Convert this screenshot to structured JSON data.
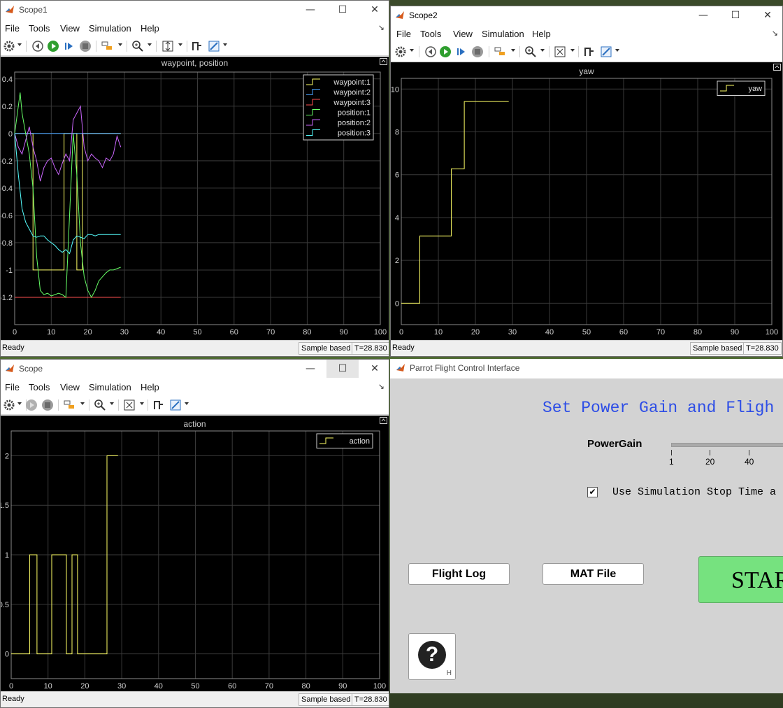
{
  "menus": [
    "File",
    "Tools",
    "View",
    "Simulation",
    "Help"
  ],
  "status": {
    "ready": "Ready",
    "mode": "Sample based",
    "time": "T=28.830"
  },
  "scope1": {
    "title": "Scope1",
    "plot_title": "waypoint, position",
    "chart_data": {
      "type": "line",
      "title": "waypoint, position",
      "xlim": [
        0,
        100
      ],
      "ylim": [
        -1.4,
        0.45
      ],
      "xticks": [
        0,
        10,
        20,
        30,
        40,
        50,
        60,
        70,
        80,
        90,
        100
      ],
      "yticks": [
        0.4,
        0.2,
        0,
        -0.2,
        -0.4,
        -0.6,
        -0.8,
        -1,
        -1.2
      ],
      "ytick_labels": [
        "0.4",
        "0.2",
        "0",
        "-0.2",
        "-0.4",
        "-0.6",
        "-0.8",
        "-1",
        "-1.2"
      ],
      "grid": true,
      "legend_position": "top-right",
      "series": [
        {
          "name": "waypoint:1",
          "color": "#ffff66",
          "x": [
            0,
            5,
            5,
            13.5,
            13.5,
            17,
            17,
            18.5,
            18.5,
            29
          ],
          "y": [
            0,
            0,
            -1,
            -1,
            0,
            0,
            -1,
            -1,
            0,
            0
          ]
        },
        {
          "name": "waypoint:2",
          "color": "#4aa3ff",
          "x": [
            0,
            29
          ],
          "y": [
            0,
            0
          ]
        },
        {
          "name": "waypoint:3",
          "color": "#ff5050",
          "x": [
            0,
            29
          ],
          "y": [
            -1.2,
            -1.2
          ]
        },
        {
          "name": "position:1",
          "color": "#66ff66",
          "x": [
            0,
            1,
            1.5,
            2,
            3,
            4,
            5,
            6,
            7,
            8,
            9,
            10,
            11,
            12,
            13,
            14,
            15,
            16,
            17,
            18,
            19,
            20,
            21,
            22,
            23,
            24,
            25,
            26,
            27,
            28,
            29
          ],
          "y": [
            0,
            0.2,
            0.3,
            0.15,
            0,
            -0.15,
            -0.4,
            -0.9,
            -1.15,
            -1.18,
            -1.17,
            -1.19,
            -1.18,
            -1.17,
            -1.18,
            -1.2,
            -0.6,
            0,
            -0.3,
            -0.8,
            -1.05,
            -1.15,
            -1.2,
            -1.15,
            -1.08,
            -1.05,
            -1.02,
            -1.0,
            -1.0,
            -0.99,
            -0.98
          ]
        },
        {
          "name": "position:2",
          "color": "#cc66ff",
          "x": [
            0,
            1,
            2,
            3,
            4,
            5,
            6,
            7,
            8,
            9,
            10,
            11,
            12,
            13,
            14,
            15,
            16,
            17,
            18,
            19,
            20,
            21,
            22,
            23,
            24,
            25,
            26,
            27,
            28,
            29
          ],
          "y": [
            0,
            -0.1,
            -0.15,
            -0.05,
            0.05,
            -0.1,
            -0.2,
            -0.35,
            -0.25,
            -0.2,
            -0.18,
            -0.25,
            -0.3,
            -0.22,
            -0.15,
            -0.2,
            0.1,
            0.15,
            0.2,
            -0.1,
            -0.2,
            -0.15,
            -0.18,
            -0.2,
            -0.25,
            -0.18,
            -0.2,
            -0.15,
            -0.02,
            -0.1
          ]
        },
        {
          "name": "position:3",
          "color": "#55ffff",
          "x": [
            0,
            1,
            2,
            3,
            4,
            5,
            6,
            7,
            8,
            9,
            10,
            11,
            12,
            13,
            14,
            15,
            16,
            17,
            18,
            19,
            20,
            21,
            22,
            23,
            24,
            25,
            26,
            27,
            28,
            29
          ],
          "y": [
            0,
            -0.3,
            -0.55,
            -0.65,
            -0.7,
            -0.75,
            -0.76,
            -0.75,
            -0.75,
            -0.78,
            -0.8,
            -0.82,
            -0.85,
            -0.87,
            -0.85,
            -0.88,
            -0.78,
            -0.75,
            -0.76,
            -0.77,
            -0.74,
            -0.74,
            -0.75,
            -0.74,
            -0.74,
            -0.74,
            -0.74,
            -0.74,
            -0.74,
            -0.74
          ]
        }
      ]
    }
  },
  "scope2": {
    "title": "Scope2",
    "plot_title": "yaw",
    "chart_data": {
      "type": "line",
      "title": "yaw",
      "xlim": [
        0,
        100
      ],
      "ylim": [
        -1,
        10.5
      ],
      "xticks": [
        0,
        10,
        20,
        30,
        40,
        50,
        60,
        70,
        80,
        90,
        100
      ],
      "yticks": [
        0,
        2,
        4,
        6,
        8,
        10
      ],
      "grid": true,
      "legend_position": "top-right",
      "series": [
        {
          "name": "yaw",
          "color": "#ffff66",
          "x": [
            0,
            5,
            5,
            13.5,
            13.5,
            17,
            17,
            29
          ],
          "y": [
            0,
            0,
            3.14,
            3.14,
            6.28,
            6.28,
            9.42,
            9.42
          ]
        }
      ]
    }
  },
  "scope": {
    "title": "Scope",
    "plot_title": "action",
    "chart_data": {
      "type": "line",
      "title": "action",
      "xlim": [
        0,
        100
      ],
      "ylim": [
        -0.25,
        2.25
      ],
      "xticks": [
        0,
        10,
        20,
        30,
        40,
        50,
        60,
        70,
        80,
        90,
        100
      ],
      "yticks": [
        0,
        0.5,
        1,
        1.5,
        2
      ],
      "ytick_labels": [
        "0",
        "0.5",
        "1",
        "1.5",
        "2"
      ],
      "grid": true,
      "legend_position": "top-right",
      "series": [
        {
          "name": "action",
          "color": "#ffff66",
          "x": [
            0,
            5,
            5,
            7,
            7,
            11,
            11,
            15,
            15,
            16.5,
            16.5,
            18,
            18,
            19,
            19,
            26,
            26,
            29
          ],
          "y": [
            0,
            0,
            1,
            1,
            0,
            0,
            1,
            1,
            0,
            0,
            1,
            1,
            0,
            0,
            0,
            0,
            2,
            2
          ]
        }
      ]
    }
  },
  "control": {
    "title": "Parrot Flight Control Interface",
    "heading": "Set Power Gain and Fligh",
    "powergain_label": "PowerGain",
    "slider_ticks": [
      "1",
      "20",
      "40"
    ],
    "checkbox_label": "Use Simulation Stop Time a",
    "checkbox_checked": true,
    "flight_log": "Flight Log",
    "mat_file": "MAT File",
    "start": "STAR",
    "help_symbol": "?",
    "help_hint": "H"
  }
}
